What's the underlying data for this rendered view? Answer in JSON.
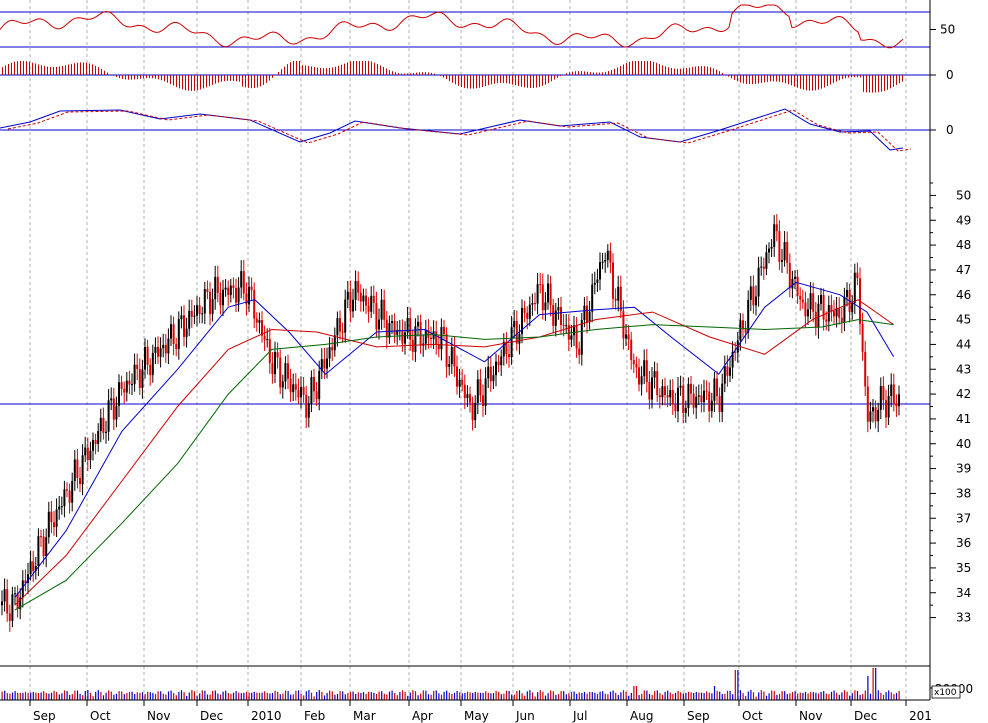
{
  "chart_data": {
    "type": "candlestick",
    "months": [
      "Sep",
      "Oct",
      "Nov",
      "Dec",
      "2010",
      "Feb",
      "Mar",
      "Apr",
      "May",
      "Jun",
      "Jul",
      "Aug",
      "Sep",
      "Oct",
      "Nov",
      "Dec",
      "201"
    ],
    "price_axis": {
      "ticks": [
        33,
        34,
        35,
        36,
        37,
        38,
        39,
        40,
        41,
        42,
        43,
        44,
        45,
        46,
        47,
        48,
        49,
        50
      ],
      "range": [
        32.5,
        50.5
      ]
    },
    "support_line": 41.6,
    "price_key_closes": [
      {
        "date": "2009-08-24",
        "close": 33.5
      },
      {
        "date": "2009-09-10",
        "close": 36.5
      },
      {
        "date": "2009-09-25",
        "close": 38.7
      },
      {
        "date": "2009-10-20",
        "close": 42.2
      },
      {
        "date": "2009-11-20",
        "close": 44.5
      },
      {
        "date": "2009-12-10",
        "close": 46.0
      },
      {
        "date": "2009-12-31",
        "close": 46.3
      },
      {
        "date": "2010-01-15",
        "close": 43.3
      },
      {
        "date": "2010-02-05",
        "close": 41.6
      },
      {
        "date": "2010-03-03",
        "close": 46.2
      },
      {
        "date": "2010-03-25",
        "close": 44.5
      },
      {
        "date": "2010-04-20",
        "close": 44.2
      },
      {
        "date": "2010-05-07",
        "close": 41.4
      },
      {
        "date": "2010-05-25",
        "close": 43.5
      },
      {
        "date": "2010-06-15",
        "close": 46.2
      },
      {
        "date": "2010-07-05",
        "close": 44.0
      },
      {
        "date": "2010-07-20",
        "close": 47.8
      },
      {
        "date": "2010-08-05",
        "close": 43.0
      },
      {
        "date": "2010-08-25",
        "close": 41.8
      },
      {
        "date": "2010-09-20",
        "close": 41.9
      },
      {
        "date": "2010-10-05",
        "close": 45.2
      },
      {
        "date": "2010-10-20",
        "close": 48.5
      },
      {
        "date": "2010-11-05",
        "close": 45.5
      },
      {
        "date": "2010-11-25",
        "close": 45.2
      },
      {
        "date": "2010-12-05",
        "close": 46.5
      },
      {
        "date": "2010-12-10",
        "close": 41.0
      },
      {
        "date": "2010-12-20",
        "close": 41.8
      }
    ],
    "moving_averages": [
      {
        "color": "#0000cc",
        "values": [
          {
            "date": "2009-08-24",
            "v": 33.8
          },
          {
            "date": "2009-09-20",
            "v": 36.5
          },
          {
            "date": "2009-10-20",
            "v": 40.5
          },
          {
            "date": "2009-11-20",
            "v": 43.0
          },
          {
            "date": "2009-12-20",
            "v": 45.5
          },
          {
            "date": "2010-01-05",
            "v": 45.8
          },
          {
            "date": "2010-01-25",
            "v": 44.5
          },
          {
            "date": "2010-02-15",
            "v": 42.8
          },
          {
            "date": "2010-03-15",
            "v": 44.5
          },
          {
            "date": "2010-04-10",
            "v": 44.6
          },
          {
            "date": "2010-05-15",
            "v": 43.3
          },
          {
            "date": "2010-06-15",
            "v": 45.2
          },
          {
            "date": "2010-07-15",
            "v": 45.4
          },
          {
            "date": "2010-08-05",
            "v": 45.5
          },
          {
            "date": "2010-08-25",
            "v": 44.3
          },
          {
            "date": "2010-09-20",
            "v": 42.8
          },
          {
            "date": "2010-10-15",
            "v": 45.5
          },
          {
            "date": "2010-11-01",
            "v": 46.5
          },
          {
            "date": "2010-11-25",
            "v": 46.0
          },
          {
            "date": "2010-12-10",
            "v": 45.3
          },
          {
            "date": "2010-12-25",
            "v": 43.5
          }
        ]
      },
      {
        "color": "#cc0000",
        "values": [
          {
            "date": "2009-08-24",
            "v": 33.5
          },
          {
            "date": "2009-09-20",
            "v": 35.5
          },
          {
            "date": "2009-10-20",
            "v": 38.5
          },
          {
            "date": "2009-11-20",
            "v": 41.5
          },
          {
            "date": "2009-12-20",
            "v": 43.8
          },
          {
            "date": "2010-01-15",
            "v": 44.6
          },
          {
            "date": "2010-02-10",
            "v": 44.5
          },
          {
            "date": "2010-03-15",
            "v": 43.9
          },
          {
            "date": "2010-04-15",
            "v": 44.0
          },
          {
            "date": "2010-05-15",
            "v": 43.9
          },
          {
            "date": "2010-06-15",
            "v": 44.3
          },
          {
            "date": "2010-07-15",
            "v": 45.0
          },
          {
            "date": "2010-08-15",
            "v": 45.3
          },
          {
            "date": "2010-09-15",
            "v": 44.3
          },
          {
            "date": "2010-10-15",
            "v": 43.6
          },
          {
            "date": "2010-11-10",
            "v": 45.0
          },
          {
            "date": "2010-12-05",
            "v": 45.8
          },
          {
            "date": "2010-12-25",
            "v": 44.8
          }
        ]
      },
      {
        "color": "#006600",
        "values": [
          {
            "date": "2009-08-24",
            "v": 33.3
          },
          {
            "date": "2009-09-20",
            "v": 34.5
          },
          {
            "date": "2009-10-20",
            "v": 36.8
          },
          {
            "date": "2009-11-20",
            "v": 39.2
          },
          {
            "date": "2009-12-20",
            "v": 42.0
          },
          {
            "date": "2010-01-15",
            "v": 43.8
          },
          {
            "date": "2010-02-15",
            "v": 44.0
          },
          {
            "date": "2010-03-15",
            "v": 44.3
          },
          {
            "date": "2010-04-15",
            "v": 44.4
          },
          {
            "date": "2010-05-15",
            "v": 44.2
          },
          {
            "date": "2010-06-15",
            "v": 44.3
          },
          {
            "date": "2010-07-15",
            "v": 44.6
          },
          {
            "date": "2010-08-15",
            "v": 44.8
          },
          {
            "date": "2010-09-15",
            "v": 44.7
          },
          {
            "date": "2010-10-15",
            "v": 44.6
          },
          {
            "date": "2010-11-15",
            "v": 44.7
          },
          {
            "date": "2010-12-05",
            "v": 45.0
          },
          {
            "date": "2010-12-25",
            "v": 44.8
          }
        ]
      }
    ],
    "indicator_panels": [
      {
        "kind": "oscillator_line",
        "labels": [
          "50"
        ],
        "reference_levels": [
          70,
          50,
          30
        ]
      },
      {
        "kind": "histogram",
        "labels": [
          "0"
        ]
      },
      {
        "kind": "macd",
        "labels": [
          "0"
        ]
      }
    ],
    "volume_panel": {
      "tick_label": "20000",
      "multiplier_label": "x100"
    }
  }
}
